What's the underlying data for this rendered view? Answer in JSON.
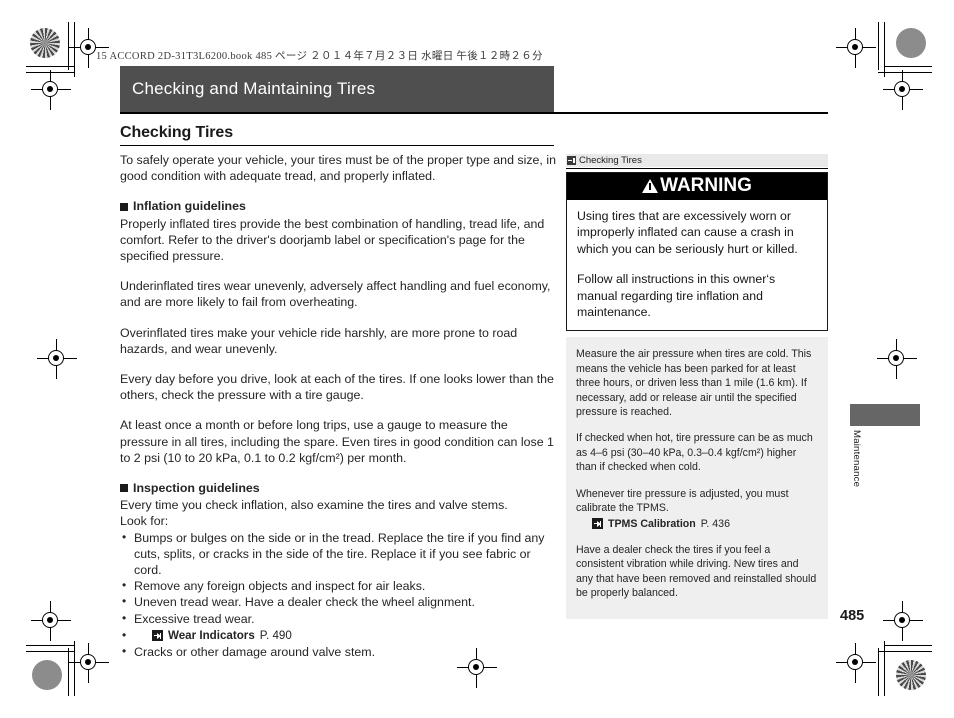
{
  "print": {
    "runhead": "15 ACCORD 2D-31T3L6200.book   485 ページ   ２０１４年７月２３日   水曜日   午後１２時２６分"
  },
  "banner": {
    "title": "Checking and Maintaining Tires"
  },
  "section": {
    "heading": "Checking Tires"
  },
  "main": {
    "intro": "To safely operate your vehicle, your tires must be of the proper type and size, in good condition with adequate tread, and properly inflated.",
    "inflation": {
      "subhead": "Inflation guidelines",
      "p1": "Properly inflated tires provide the best combination of handling, tread life, and comfort. Refer to the driver's doorjamb label or specification's page for the specified pressure.",
      "p2": "Underinflated tires wear unevenly, adversely affect handling and fuel economy, and are more likely to fail from overheating.",
      "p3": "Overinflated tires make your vehicle ride harshly, are more prone to road hazards, and wear unevenly.",
      "p4": "Every day before you drive, look at each of the tires. If one looks lower than the others, check the pressure with a tire gauge.",
      "p5": "At least once a month or before long trips, use a gauge to measure the pressure in all tires, including the spare. Even tires in good condition can lose 1 to 2 psi (10 to 20 kPa, 0.1 to 0.2 kgf/cm²) per month."
    },
    "inspection": {
      "subhead": "Inspection guidelines",
      "lead1": "Every time you check inflation, also examine the tires and valve stems.",
      "lead2": "Look for:",
      "items": [
        "Bumps or bulges on the side or in the tread. Replace the tire if you find any cuts, splits, or cracks in the side of the tire. Replace it if you see fabric or cord.",
        "Remove any foreign objects and inspect for air leaks.",
        "Uneven tread wear. Have a dealer check the wheel alignment.",
        "Excessive tread wear.",
        "Cracks or other damage around valve stem."
      ],
      "xref": {
        "title": "Wear Indicators",
        "page": "P. 490"
      }
    }
  },
  "sidebar": {
    "head_label": "Checking Tires",
    "warning": {
      "label": "WARNING",
      "p1": "Using tires that are excessively worn or improperly inflated can cause a crash in which you can be seriously hurt or killed.",
      "p2": "Follow all instructions in this owner‘s manual regarding tire inflation and maintenance."
    },
    "notes": {
      "n1": "Measure the air pressure when tires are cold. This means the vehicle has been parked for at least three hours, or driven less than 1 mile (1.6 km). If necessary, add or release air until the specified pressure is reached.",
      "n2": "If checked when hot, tire pressure can be as much as 4–6 psi (30–40 kPa, 0.3–0.4 kgf/cm²) higher than if checked when cold.",
      "n3": "Whenever tire pressure is adjusted, you must calibrate the TPMS.",
      "xref": {
        "title": "TPMS Calibration",
        "page": "P. 436"
      },
      "n4": "Have a dealer check the tires if you feel a consistent vibration while driving. New tires and any that have been removed and reinstalled should be properly balanced."
    }
  },
  "thumb": {
    "label": "Maintenance"
  },
  "folio": {
    "page_number": "485"
  },
  "colors": {
    "banner_bg": "#4f4f4f",
    "warning_bg": "#000000",
    "note_bg": "#efefef",
    "thumb_tab": "#666666"
  }
}
